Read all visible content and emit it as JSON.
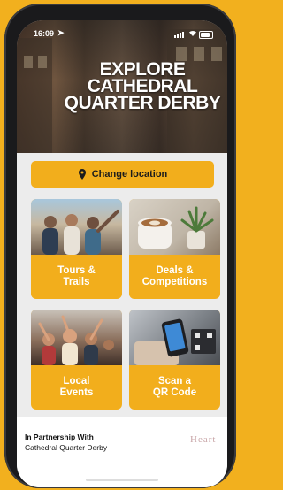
{
  "status_bar": {
    "time": "16:09",
    "location_arrow": "➤"
  },
  "hero": {
    "title_lines": [
      "EXPLORE",
      "CATHEDRAL",
      "QUARTER DERBY"
    ]
  },
  "location_button": {
    "icon": "map-pin-icon",
    "label": "Change location"
  },
  "tiles": [
    {
      "line1": "Tours &",
      "line2": "Trails",
      "photo": "group-of-friends"
    },
    {
      "line1": "Deals &",
      "line2": "Competitions",
      "photo": "coffee-cup"
    },
    {
      "line1": "Local",
      "line2": "Events",
      "photo": "crowd-at-event"
    },
    {
      "line1": "Scan a",
      "line2": "QR Code",
      "photo": "phone-scanning"
    }
  ],
  "partner": {
    "heading": "In Partnership With",
    "name": "Cathedral Quarter Derby",
    "logo_text": "Heart"
  },
  "colors": {
    "accent": "#F2AE1C",
    "background": "#F2B01E",
    "tile_text": "#ffffff"
  }
}
